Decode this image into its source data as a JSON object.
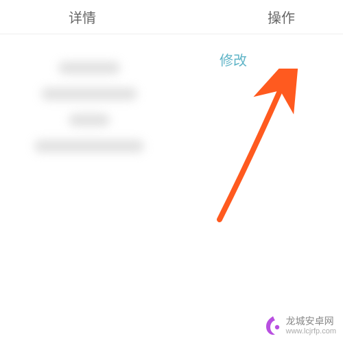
{
  "header": {
    "details_label": "详情",
    "action_label": "操作"
  },
  "row": {
    "edit_label": "修改"
  },
  "watermark": {
    "title": "龙城安卓网",
    "url": "www.lcjrfp.com"
  },
  "annotation": {
    "arrow_color": "#ff5a1f"
  }
}
